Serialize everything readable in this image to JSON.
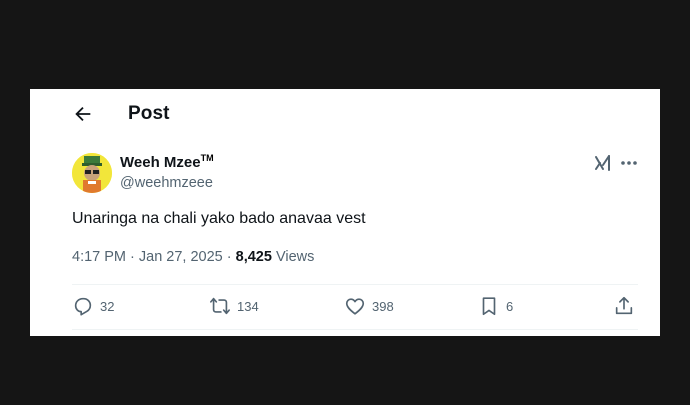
{
  "header": {
    "title": "Post"
  },
  "tweet": {
    "author": {
      "display_name": "Weeh Mzee",
      "badge": "TM",
      "handle": "@weehmzeee"
    },
    "text": "Unaringa na chali yako bado anavaa vest",
    "time": "4:17 PM",
    "sep1": " · ",
    "date": "Jan 27, 2025",
    "sep2": " · ",
    "views_count": "8,425",
    "views_label": " Views"
  },
  "actions": {
    "replies": "32",
    "reposts": "134",
    "likes": "398",
    "bookmarks": "6"
  },
  "icons": [
    "back-arrow-icon",
    "grok-icon",
    "more-icon",
    "reply-icon",
    "repost-icon",
    "like-icon",
    "bookmark-icon",
    "share-icon"
  ],
  "colors": {
    "background": "#151515",
    "card": "#ffffff",
    "text": "#0f1419",
    "secondary": "#536471"
  }
}
